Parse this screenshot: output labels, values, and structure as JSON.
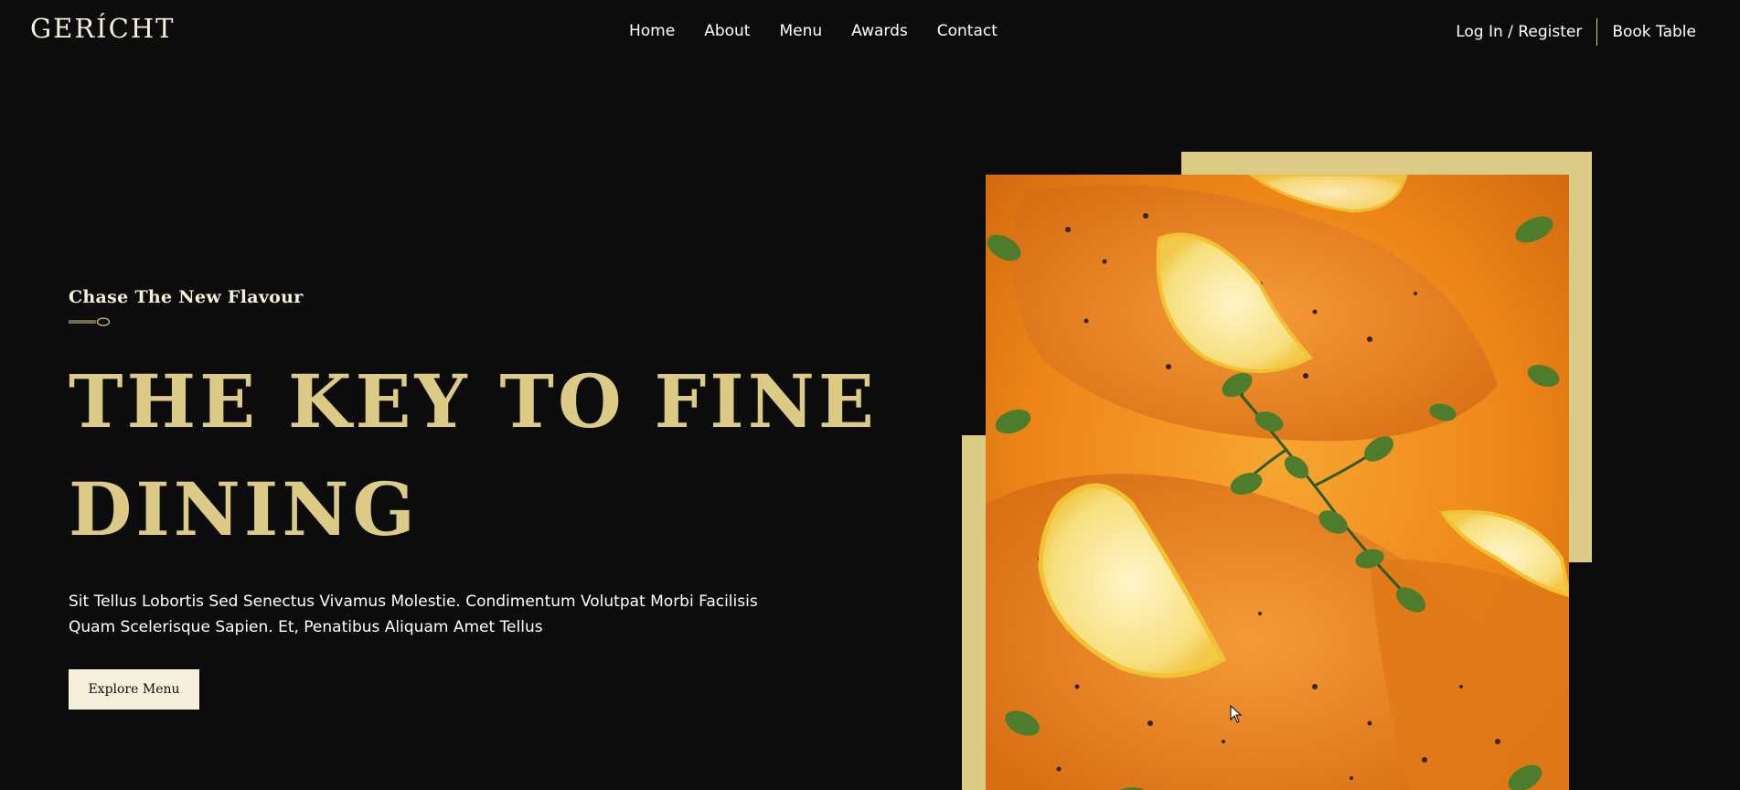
{
  "header": {
    "logo": "GERÍCHT",
    "nav": {
      "items": [
        "Home",
        "About",
        "Menu",
        "Awards",
        "Contact"
      ]
    },
    "login_label": "Log In / Register",
    "book_label": "Book Table"
  },
  "hero": {
    "subtitle": "Chase The New Flavour",
    "headline": "THE KEY TO FINE DINING",
    "description": "Sit Tellus Lobortis Sed Senectus Vivamus Molestie. Condimentum Volutpat Morbi Facilisis Quam Scelerisque Sapien. Et, Penatibus Aliquam Amet Tellus",
    "cta_label": "Explore Menu",
    "image_icon": "salmon-dish-image",
    "divider_icon": "spoon-icon"
  },
  "colors": {
    "background": "#0c0c0c",
    "accent_gold": "#dcca87",
    "cream": "#f5efdb",
    "food_orange": "#f08a1a"
  }
}
